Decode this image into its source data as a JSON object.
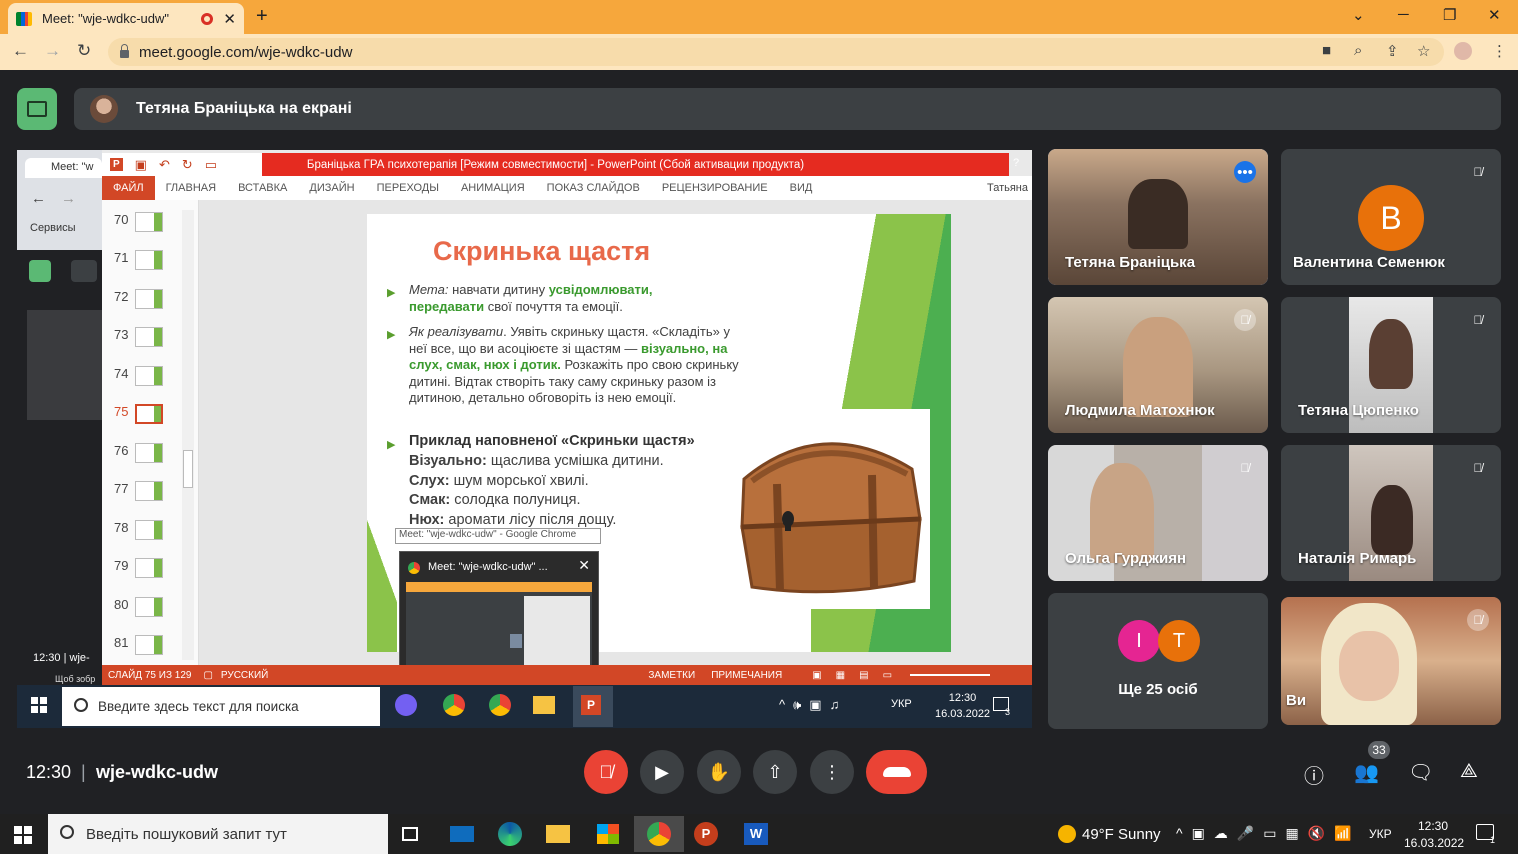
{
  "browser": {
    "tab_title": "Meet: \"wje-wdkc-udw\"",
    "new_tab": "+",
    "url": "meet.google.com/wje-wdkc-udw",
    "window_controls": [
      "⌄",
      "─",
      "❐",
      "✕"
    ]
  },
  "meet": {
    "presenter_text": "Тетяна Браніцька на екрані",
    "time": "12:30",
    "meeting_code": "wje-wdkc-udw",
    "participant_count": "33",
    "tiles": [
      {
        "name": "Тетяна Браніцька",
        "muted": false,
        "active": true
      },
      {
        "name": "Валентина Семенюк",
        "initial": "В",
        "muted": true
      },
      {
        "name": "Людмила Матохнюк",
        "muted": true
      },
      {
        "name": "Тетяна Цюпенко",
        "muted": true
      },
      {
        "name": "Ольга Гурджиян",
        "muted": true
      },
      {
        "name": "Наталія Римарь",
        "muted": true
      },
      {
        "name": "Ще 25 осіб",
        "initials": [
          "І",
          "Т"
        ]
      },
      {
        "name": "Ви",
        "muted": true
      }
    ]
  },
  "shared_screen": {
    "left_tab": "Meet: \"w",
    "services": "Сервисы",
    "left_clock": "12:30",
    "left_code": "wje-",
    "left_hint": "Щоб зобр екран або вкладку а",
    "ppt_title": "Браніцька ГРА психотерапія [Режим совместимости] - PowerPoint (Сбой активации продукта)",
    "ribbon_tabs": [
      "ФАЙЛ",
      "ГЛАВНАЯ",
      "ВСТАВКА",
      "ДИЗАЙН",
      "ПЕРЕХОДЫ",
      "АНИМАЦИЯ",
      "ПОКАЗ СЛАЙДОВ",
      "РЕЦЕНЗИРОВАНИЕ",
      "ВИД"
    ],
    "user": "Татьяна",
    "help": "?",
    "thumb_numbers": [
      "70",
      "71",
      "72",
      "73",
      "74",
      "75",
      "76",
      "77",
      "78",
      "79",
      "80",
      "81"
    ],
    "selected_slide": "75",
    "slide": {
      "title": "Скринька щастя",
      "b1_label": "Мета:",
      "b1_text1": " навчати дитину ",
      "b1_green": "усвідомлювати, передавати",
      "b1_text2": " свої почуття та емоції.",
      "b2_label": "Як реалізувати",
      "b2_text1": ". Уявіть скриньку щастя. «Складіть» у неї все, що ви асоціюєте зі щастям — ",
      "b2_green": "візуально, на слух, смак, нюх і дотик.",
      "b2_text2": " Розкажіть про свою скриньку дитині. Відтак створіть таку саму скриньку разом із дитиною, детально обговоріть із нею емоції.",
      "b3_title": "Приклад наповненої «Скриньки щастя»",
      "rows": [
        {
          "k": "Візуально:",
          "v": " щаслива усмішка дитини."
        },
        {
          "k": "Слух:",
          "v": " шум морської хвилі."
        },
        {
          "k": "Смак:",
          "v": " солодка полуниця."
        },
        {
          "k": "Нюх:",
          "v": " аромати лісу після дощу."
        }
      ]
    },
    "tooltip": "Meet: \"wje-wdkc-udw\" - Google Chrome",
    "popup_title": "Meet: \"wje-wdkc-udw\" ...",
    "status": {
      "slide": "СЛАЙД 75 ИЗ 129",
      "lang": "РУССКИЙ",
      "notes": "ЗАМЕТКИ",
      "comments": "ПРИМЕЧАНИЯ"
    },
    "inner_taskbar": {
      "search": "Введите здесь текст для поиска",
      "lang": "УКР",
      "time": "12:30",
      "date": "16.03.2022",
      "notif": "3"
    }
  },
  "taskbar": {
    "search_placeholder": "Введіть пошуковий запит тут",
    "weather": "49°F  Sunny",
    "lang": "УКР",
    "time": "12:30",
    "date": "16.03.2022",
    "notif": "1"
  },
  "colors": {
    "chrome_tabstrip": "#f6a73c",
    "meet_bg": "#202124",
    "end_call": "#ea4335",
    "present_green": "#5bb974",
    "ppt_accent": "#d24726",
    "avatar_orange": "#e8710a",
    "avatar_pink": "#e52592"
  }
}
